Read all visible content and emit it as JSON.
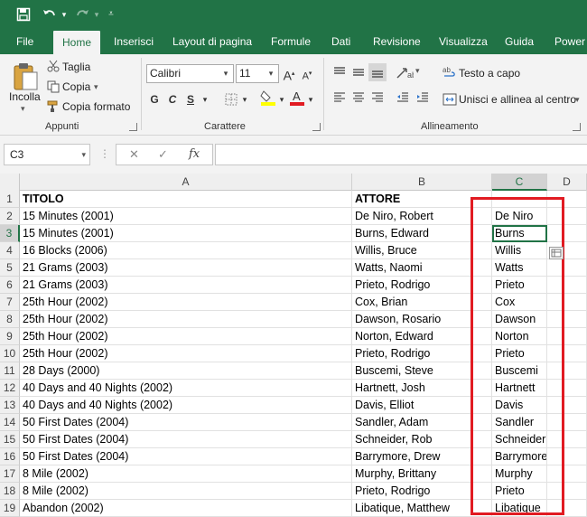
{
  "quick_access": {
    "save_icon": "save-icon",
    "undo_icon": "undo-icon",
    "redo_icon": "redo-icon",
    "customize_icon": "customize-icon"
  },
  "tabs": [
    {
      "label": "File",
      "active": false
    },
    {
      "label": "Home",
      "active": true
    },
    {
      "label": "Inserisci",
      "active": false
    },
    {
      "label": "Layout di pagina",
      "active": false
    },
    {
      "label": "Formule",
      "active": false
    },
    {
      "label": "Dati",
      "active": false
    },
    {
      "label": "Revisione",
      "active": false
    },
    {
      "label": "Visualizza",
      "active": false
    },
    {
      "label": "Guida",
      "active": false
    },
    {
      "label": "Power Pi",
      "active": false
    }
  ],
  "ribbon": {
    "clipboard": {
      "paste_label": "Incolla",
      "cut_label": "Taglia",
      "copy_label": "Copia",
      "format_painter_label": "Copia formato",
      "group_label": "Appunti"
    },
    "font": {
      "font_name": "Calibri",
      "font_size": "11",
      "bold": "G",
      "italic": "C",
      "underline": "S",
      "grow_label": "A",
      "shrink_label": "A",
      "group_label": "Carattere"
    },
    "alignment": {
      "wrap_label": "Testo a capo",
      "merge_label": "Unisci e allinea al centro",
      "group_label": "Allineamento"
    }
  },
  "formula_bar": {
    "name_box": "C3",
    "cancel": "✕",
    "enter": "✓",
    "fx": "fx",
    "content": ""
  },
  "sheet": {
    "columns": [
      "A",
      "B",
      "C",
      "D"
    ],
    "selected_cell": "C3",
    "rows": [
      {
        "n": "1",
        "a": "TITOLO",
        "b": "ATTORE",
        "c": ""
      },
      {
        "n": "2",
        "a": "15 Minutes (2001)",
        "b": "De Niro, Robert",
        "c": "De Niro"
      },
      {
        "n": "3",
        "a": "15 Minutes (2001)",
        "b": "Burns, Edward",
        "c": "Burns"
      },
      {
        "n": "4",
        "a": "16 Blocks (2006)",
        "b": "Willis, Bruce",
        "c": "Willis"
      },
      {
        "n": "5",
        "a": "21 Grams (2003)",
        "b": "Watts, Naomi",
        "c": "Watts"
      },
      {
        "n": "6",
        "a": "21 Grams (2003)",
        "b": "Prieto, Rodrigo",
        "c": "Prieto"
      },
      {
        "n": "7",
        "a": "25th Hour (2002)",
        "b": "Cox, Brian",
        "c": "Cox"
      },
      {
        "n": "8",
        "a": "25th Hour (2002)",
        "b": "Dawson, Rosario",
        "c": "Dawson"
      },
      {
        "n": "9",
        "a": "25th Hour (2002)",
        "b": "Norton, Edward",
        "c": "Norton"
      },
      {
        "n": "10",
        "a": "25th Hour (2002)",
        "b": "Prieto, Rodrigo",
        "c": "Prieto"
      },
      {
        "n": "11",
        "a": "28 Days (2000)",
        "b": "Buscemi, Steve",
        "c": "Buscemi"
      },
      {
        "n": "12",
        "a": "40 Days and 40 Nights (2002)",
        "b": "Hartnett, Josh",
        "c": "Hartnett"
      },
      {
        "n": "13",
        "a": "40 Days and 40 Nights (2002)",
        "b": "Davis, Elliot",
        "c": "Davis"
      },
      {
        "n": "14",
        "a": "50 First Dates (2004)",
        "b": "Sandler, Adam",
        "c": "Sandler"
      },
      {
        "n": "15",
        "a": "50 First Dates (2004)",
        "b": "Schneider, Rob",
        "c": "Schneider"
      },
      {
        "n": "16",
        "a": "50 First Dates (2004)",
        "b": "Barrymore, Drew",
        "c": "Barrymore"
      },
      {
        "n": "17",
        "a": "8 Mile (2002)",
        "b": "Murphy, Brittany",
        "c": "Murphy"
      },
      {
        "n": "18",
        "a": "8 Mile (2002)",
        "b": "Prieto, Rodrigo",
        "c": "Prieto"
      },
      {
        "n": "19",
        "a": "Abandon (2002)",
        "b": "Libatique, Matthew",
        "c": "Libatique"
      }
    ]
  },
  "colors": {
    "brand": "#217346",
    "highlight": "#e11b22",
    "ribbon_bg": "#f3f3f3"
  }
}
